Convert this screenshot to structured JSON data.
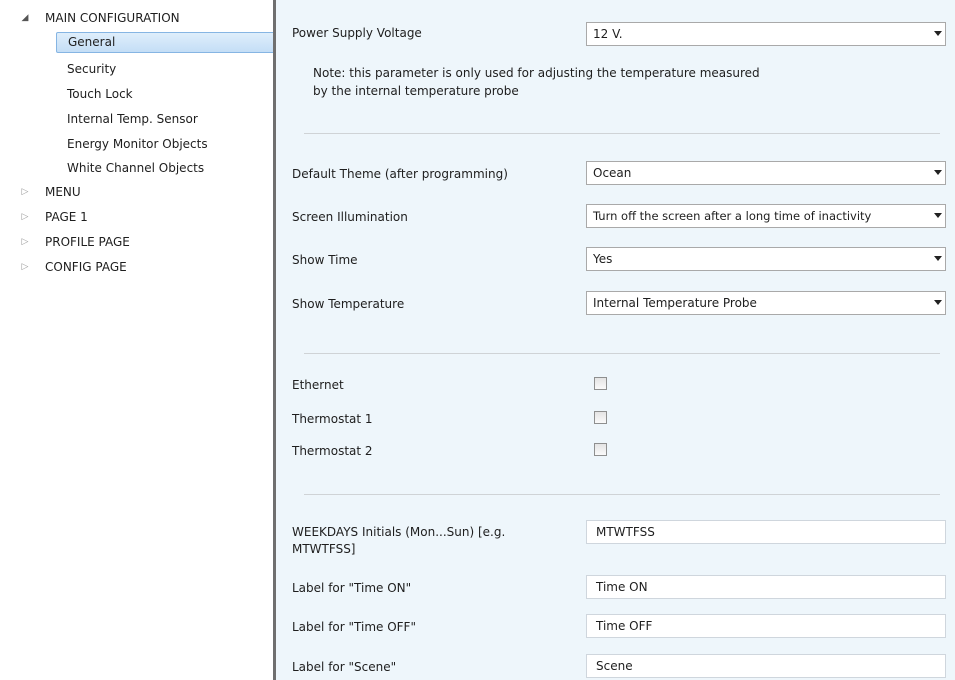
{
  "tree": {
    "root": {
      "label": "MAIN CONFIGURATION",
      "expanded": true
    },
    "children": [
      {
        "label": "General",
        "selected": true
      },
      {
        "label": "Security"
      },
      {
        "label": "Touch Lock"
      },
      {
        "label": "Internal Temp. Sensor"
      },
      {
        "label": "Energy Monitor Objects"
      },
      {
        "label": "White Channel Objects"
      }
    ],
    "collapsed": [
      {
        "label": "MENU"
      },
      {
        "label": "PAGE 1"
      },
      {
        "label": "PROFILE PAGE"
      },
      {
        "label": "CONFIG PAGE"
      }
    ]
  },
  "power_supply": {
    "label": "Power Supply Voltage",
    "value": "12 V.",
    "note": "Note: this parameter is only used for adjusting the temperature measured by the internal temperature probe"
  },
  "display": {
    "default_theme": {
      "label": "Default Theme (after programming)",
      "value": "Ocean"
    },
    "screen_illumination": {
      "label": "Screen Illumination",
      "value": "Turn off the screen after a long time of inactivity"
    },
    "show_time": {
      "label": "Show Time",
      "value": "Yes"
    },
    "show_temperature": {
      "label": "Show Temperature",
      "value": "Internal Temperature Probe"
    }
  },
  "options": {
    "ethernet": {
      "label": "Ethernet",
      "checked": false
    },
    "thermostat1": {
      "label": "Thermostat 1",
      "checked": false
    },
    "thermostat2": {
      "label": "Thermostat 2",
      "checked": false
    }
  },
  "labels": {
    "weekdays": {
      "label": "WEEKDAYS Initials (Mon...Sun) [e.g. MTWTFSS]",
      "value": "MTWTFSS"
    },
    "time_on": {
      "label": "Label for \"Time ON\"",
      "value": "Time ON"
    },
    "time_off": {
      "label": "Label for \"Time OFF\"",
      "value": "Time OFF"
    },
    "scene": {
      "label": "Label for \"Scene\"",
      "value": "Scene"
    }
  },
  "colors": {
    "panel_bg": "#eef6fb",
    "selection_bg": "#cce4f7",
    "selection_border": "#86b5e3",
    "splitter": "#6f6f6f"
  }
}
